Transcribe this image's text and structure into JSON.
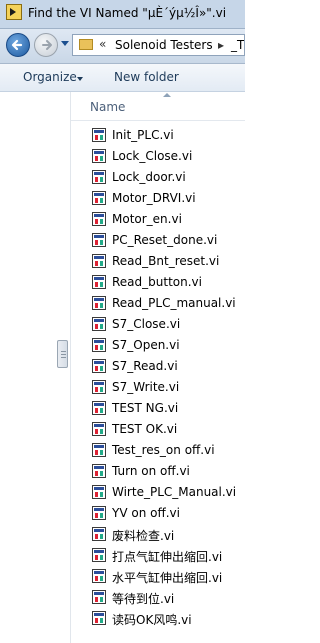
{
  "window": {
    "title": "Find the VI Named \"µÈ´ýµ½Î»\".vi"
  },
  "address": {
    "segment1": "Solenoid Testers",
    "segment2": "_TM"
  },
  "toolbar": {
    "organize": "Organize",
    "new_folder": "New folder"
  },
  "list": {
    "column_name": "Name",
    "files": [
      "Init_PLC.vi",
      "Lock_Close.vi",
      "Lock_door.vi",
      "Motor_DRVI.vi",
      "Motor_en.vi",
      "PC_Reset_done.vi",
      "Read_Bnt_reset.vi",
      "Read_button.vi",
      "Read_PLC_manual.vi",
      "S7_Close.vi",
      "S7_Open.vi",
      "S7_Read.vi",
      "S7_Write.vi",
      "TEST NG.vi",
      "TEST OK.vi",
      "Test_res_on off.vi",
      "Turn on off.vi",
      "Wirte_PLC_Manual.vi",
      "YV on off.vi",
      "废料检查.vi",
      "打点气缸伸出缩回.vi",
      "水平气缸伸出缩回.vi",
      "等待到位.vi",
      "读码OK风鸣.vi"
    ]
  },
  "icons": {
    "app": "labview-app-icon",
    "back": "back-arrow-icon",
    "forward": "forward-arrow-icon",
    "folder": "folder-icon",
    "file": "vi-file-icon"
  }
}
